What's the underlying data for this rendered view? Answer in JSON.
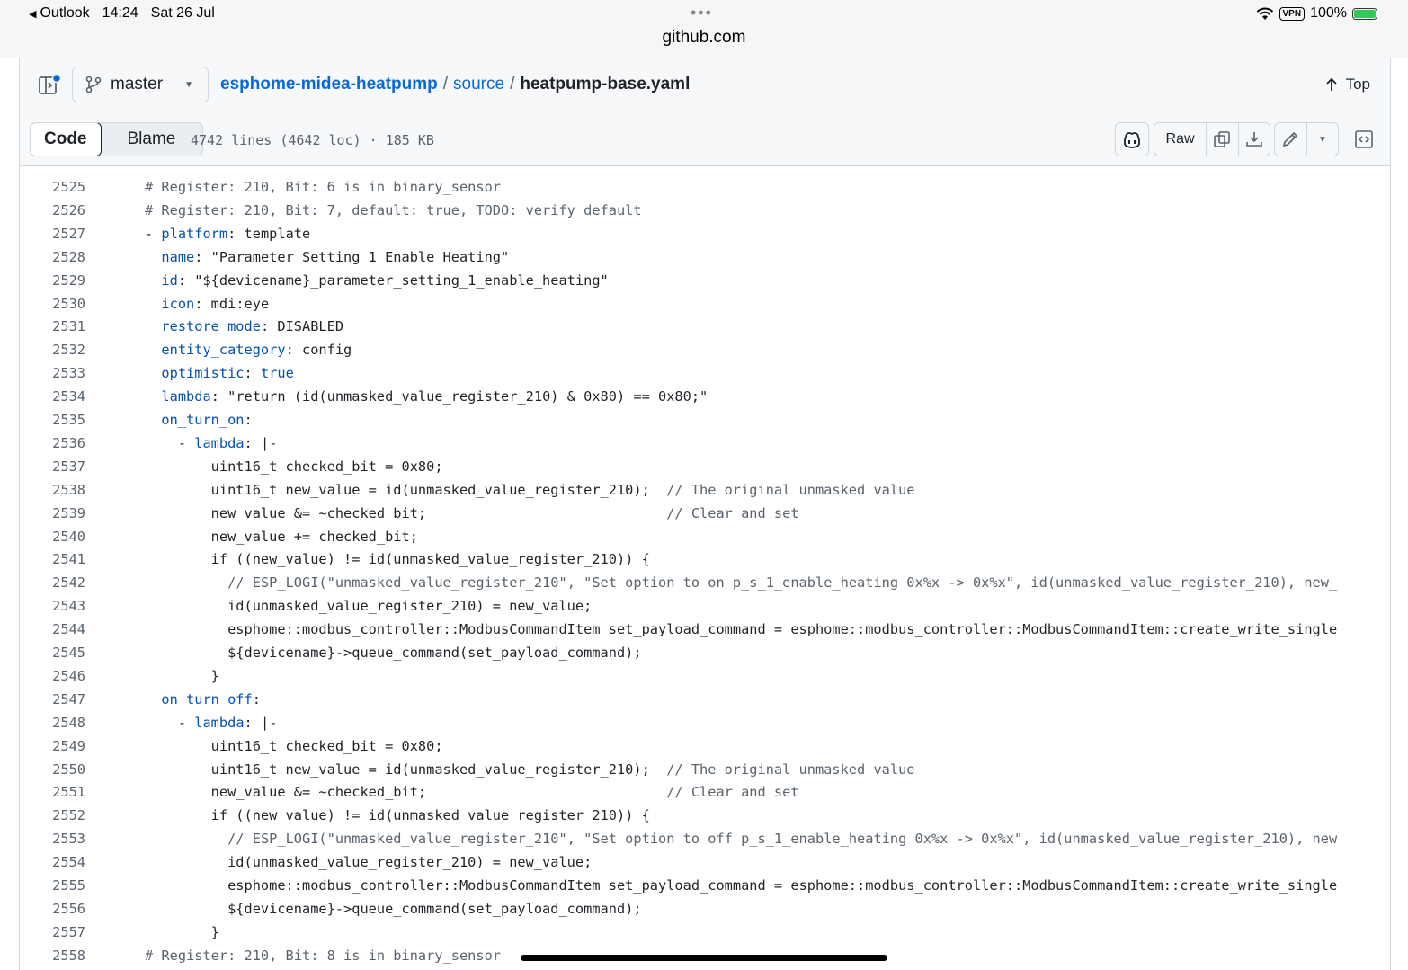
{
  "status_bar": {
    "back_app": "Outlook",
    "time": "14:24",
    "date": "Sat 26 Jul",
    "dots": "•••",
    "url": "github.com",
    "vpn": "VPN",
    "battery": "100%"
  },
  "path_bar": {
    "branch": "master",
    "repo": "esphome-midea-heatpump",
    "sep1": "/",
    "folder": "source",
    "sep2": "/",
    "file": "heatpump-base.yaml",
    "top_label": "Top"
  },
  "toolbar": {
    "code_tab": "Code",
    "blame_tab": "Blame",
    "file_info": "4742 lines (4642 loc) · 185 KB",
    "raw_label": "Raw"
  },
  "code": {
    "lines": [
      {
        "n": "2525",
        "t": "# Register: 210, Bit: 6 is in binary_sensor"
      },
      {
        "n": "2526",
        "t": "# Register: 210, Bit: 7, default: true, TODO: verify default"
      },
      {
        "n": "2527",
        "t": "- platform: template"
      },
      {
        "n": "2528",
        "t": "  name: \"Parameter Setting 1 Enable Heating\""
      },
      {
        "n": "2529",
        "t": "  id: \"${devicename}_parameter_setting_1_enable_heating\""
      },
      {
        "n": "2530",
        "t": "  icon: mdi:eye"
      },
      {
        "n": "2531",
        "t": "  restore_mode: DISABLED"
      },
      {
        "n": "2532",
        "t": "  entity_category: config"
      },
      {
        "n": "2533",
        "t": "  optimistic: true"
      },
      {
        "n": "2534",
        "t": "  lambda: \"return (id(unmasked_value_register_210) & 0x80) == 0x80;\""
      },
      {
        "n": "2535",
        "t": "  on_turn_on:"
      },
      {
        "n": "2536",
        "t": "    - lambda: |-"
      },
      {
        "n": "2537",
        "t": "        uint16_t checked_bit = 0x80;"
      },
      {
        "n": "2538",
        "t": "        uint16_t new_value = id(unmasked_value_register_210);  // The original unmasked value"
      },
      {
        "n": "2539",
        "t": "        new_value &= ~checked_bit;                             // Clear and set"
      },
      {
        "n": "2540",
        "t": "        new_value += checked_bit;"
      },
      {
        "n": "2541",
        "t": "        if ((new_value) != id(unmasked_value_register_210)) {"
      },
      {
        "n": "2542",
        "t": "          // ESP_LOGI(\"unmasked_value_register_210\", \"Set option to on p_s_1_enable_heating 0x%x -> 0x%x\", id(unmasked_value_register_210), new_"
      },
      {
        "n": "2543",
        "t": "          id(unmasked_value_register_210) = new_value;"
      },
      {
        "n": "2544",
        "t": "          esphome::modbus_controller::ModbusCommandItem set_payload_command = esphome::modbus_controller::ModbusCommandItem::create_write_single"
      },
      {
        "n": "2545",
        "t": "          ${devicename}->queue_command(set_payload_command);"
      },
      {
        "n": "2546",
        "t": "        }"
      },
      {
        "n": "2547",
        "t": "  on_turn_off:"
      },
      {
        "n": "2548",
        "t": "    - lambda: |-"
      },
      {
        "n": "2549",
        "t": "        uint16_t checked_bit = 0x80;"
      },
      {
        "n": "2550",
        "t": "        uint16_t new_value = id(unmasked_value_register_210);  // The original unmasked value"
      },
      {
        "n": "2551",
        "t": "        new_value &= ~checked_bit;                             // Clear and set"
      },
      {
        "n": "2552",
        "t": "        if ((new_value) != id(unmasked_value_register_210)) {"
      },
      {
        "n": "2553",
        "t": "          // ESP_LOGI(\"unmasked_value_register_210\", \"Set option to off p_s_1_enable_heating 0x%x -> 0x%x\", id(unmasked_value_register_210), new"
      },
      {
        "n": "2554",
        "t": "          id(unmasked_value_register_210) = new_value;"
      },
      {
        "n": "2555",
        "t": "          esphome::modbus_controller::ModbusCommandItem set_payload_command = esphome::modbus_controller::ModbusCommandItem::create_write_single"
      },
      {
        "n": "2556",
        "t": "          ${devicename}->queue_command(set_payload_command);"
      },
      {
        "n": "2557",
        "t": "        }"
      },
      {
        "n": "2558",
        "t": "# Register: 210, Bit: 8 is in binary_sensor"
      }
    ]
  },
  "colors": {
    "link": "#0969da",
    "yaml_key": "#0550ae",
    "comment": "#59636e",
    "border": "#d0d7de"
  }
}
